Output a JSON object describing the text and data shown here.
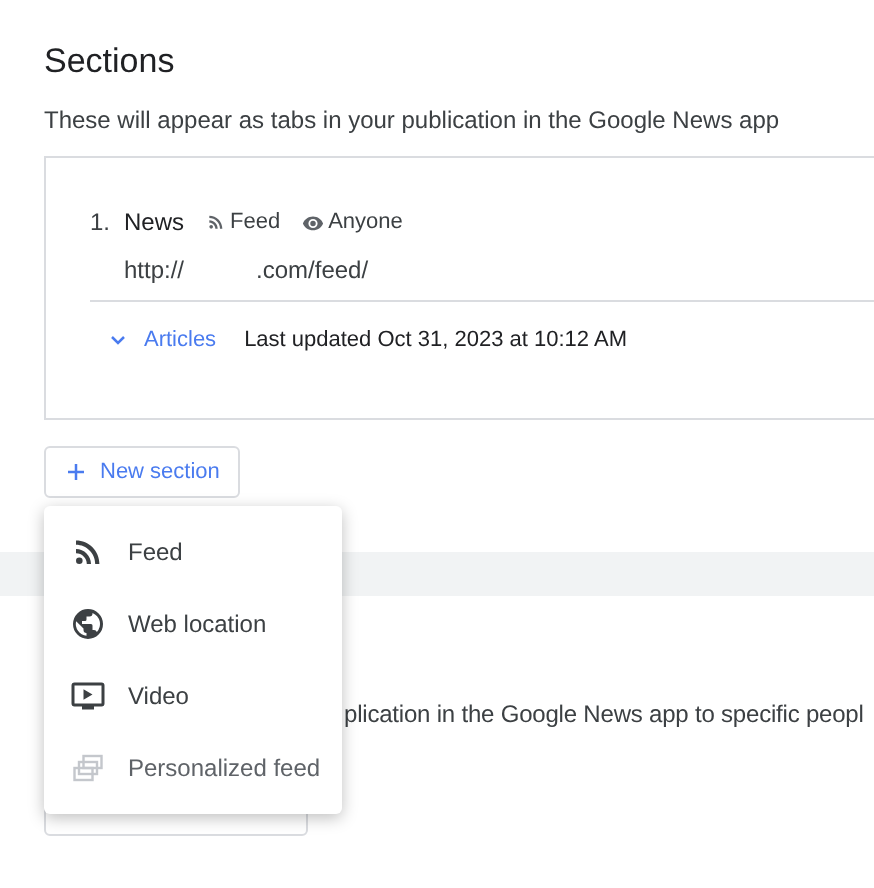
{
  "title": "Sections",
  "description": "These will appear as tabs in your publication in the Google News app",
  "sections": [
    {
      "number": "1.",
      "name": "News",
      "type": "Feed",
      "visibility": "Anyone",
      "url_start": "http://",
      "url_end": ".com/feed/",
      "content": {
        "label": "Articles",
        "expanded": false,
        "updated": "Last updated Oct 31, 2023 at 10:12 AM"
      }
    }
  ],
  "new_section_button": "New section",
  "menu": [
    {
      "kind": "feed",
      "label": "Feed",
      "disabled": false
    },
    {
      "kind": "web",
      "label": "Web location",
      "disabled": false
    },
    {
      "kind": "video",
      "label": "Video",
      "disabled": false
    },
    {
      "kind": "personalized",
      "label": "Personalized feed",
      "disabled": true
    }
  ],
  "access_description_partial": "plication in the Google News app to specific peopl"
}
